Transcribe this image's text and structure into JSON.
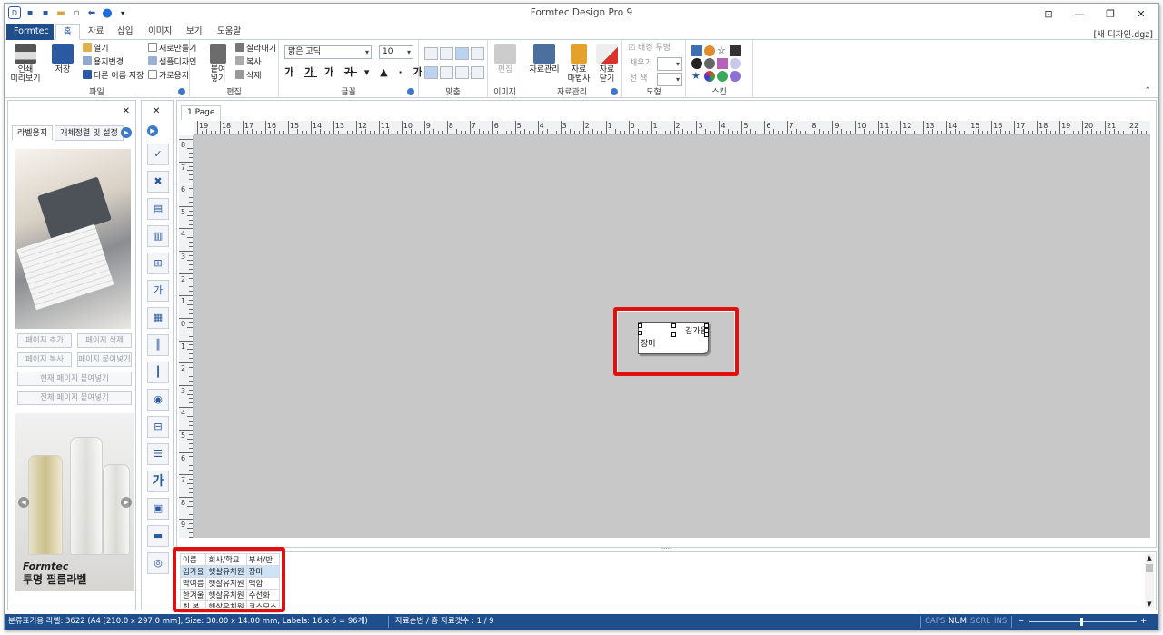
{
  "window": {
    "title": "Formtec Design Pro 9",
    "doc_name": "[새 디자인.dgz]"
  },
  "tabs": [
    "Formtec",
    "홈",
    "자료",
    "삽입",
    "이미지",
    "보기",
    "도움말"
  ],
  "ribbon": {
    "print_label": "인쇄\n미리보기",
    "save_label": "저장",
    "file_items": [
      "열기",
      "용지변경",
      "다른 이름 저장",
      "새로만들기",
      "샘플디자인",
      "가로용지"
    ],
    "group_file": "파일",
    "paste_label": "붙여\n넣기",
    "edit_items": [
      "잘라내기",
      "복사",
      "삭제"
    ],
    "group_edit": "편집",
    "font_name": "맑은 고딕",
    "font_size": "10",
    "group_font": "글꼴",
    "group_align": "맞춤",
    "image_edit_label": "편집",
    "group_image": "이미지",
    "data_mgmt_label": "자료관리",
    "data_wizard_label": "자료\n마법사",
    "data_close_label": "자료\n닫기",
    "group_data": "자료관리",
    "bg_transparent": "배경 투명",
    "fill_label": "채우기",
    "line_color_label": "선   색",
    "group_shape": "도형",
    "group_skin": "스킨"
  },
  "left_panel": {
    "tabs": [
      "라벨용지",
      "개체정렬 및 설정"
    ],
    "buttons": [
      "페이지 추가",
      "페이지 삭제",
      "페이지 복사",
      "페이지 붙여넣기",
      "현재 페이지 붙여넣기",
      "전체 페이지 붙여넣기"
    ],
    "ad_brand": "Formtec",
    "ad_title": "투명 필름라벨"
  },
  "canvas": {
    "page_tab": "1 Page",
    "h_ruler_ticks": [
      "19",
      "18",
      "17",
      "16",
      "15",
      "14",
      "13",
      "12",
      "11",
      "10",
      "9",
      "8",
      "7",
      "6",
      "5",
      "4",
      "3",
      "2",
      "1",
      "0",
      "1",
      "2",
      "3",
      "4",
      "5",
      "6",
      "7",
      "8",
      "9",
      "10",
      "11",
      "12",
      "13",
      "14",
      "15",
      "16",
      "17",
      "18",
      "19",
      "20",
      "21",
      "22"
    ],
    "v_ruler_ticks": [
      "8",
      "7",
      "6",
      "5",
      "4",
      "3",
      "2",
      "1",
      "0",
      "1",
      "2",
      "3",
      "4",
      "5",
      "6",
      "7",
      "8",
      "9"
    ],
    "label_text_1": "김가을",
    "label_text_2": "장미"
  },
  "data_grid": {
    "headers": [
      "이름",
      "회사/학교",
      "부서/반"
    ],
    "rows": [
      [
        "김가을",
        "햇살유치원",
        "장미"
      ],
      [
        "박여름",
        "햇살유치원",
        "백합"
      ],
      [
        "한겨울",
        "햇살유치원",
        "수선화"
      ],
      [
        "최 봄",
        "햇살유치원",
        "코스모스"
      ]
    ],
    "selected_row": 0
  },
  "status": {
    "info": "분류표기용 라벨: 3622 (A4 [210.0 x 297.0 mm], Size: 30.00 x 14.00 mm, Labels: 16 x 6 = 96개)",
    "record": "자료순번 / 총 자료갯수 : 1 / 9",
    "caps": "CAPS",
    "num": "NUM",
    "scrl": "SCRL",
    "ins": "INS"
  },
  "colors": {
    "accent": "#1f4e8c",
    "highlight": "#e01010",
    "workspace": "#c8c8c8"
  }
}
